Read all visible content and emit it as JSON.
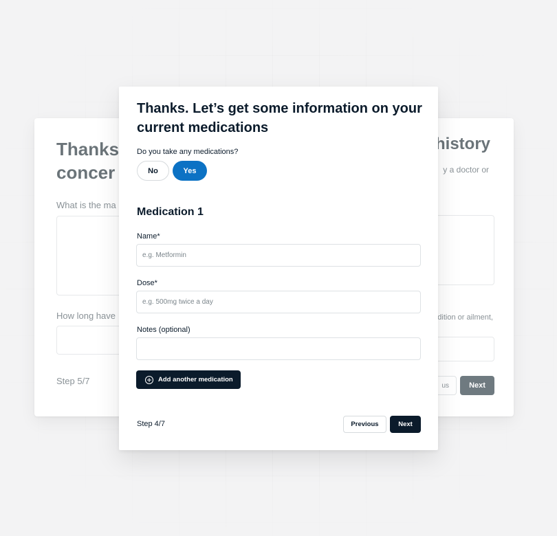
{
  "background_card": {
    "title_left": "Thanks\nconcer",
    "title_right": "history",
    "subtitle_right": "y a doctor or",
    "question_1": "What is the ma",
    "question_2": "How long have",
    "question_2_right": "dition or ailment,",
    "step": "Step 5/7",
    "previous_label": "us",
    "next_label": "Next"
  },
  "form": {
    "title": "Thanks. Let’s get some information on your current medications",
    "question": "Do you take any medications?",
    "options": [
      {
        "label": "No",
        "selected": false
      },
      {
        "label": "Yes",
        "selected": true
      }
    ],
    "section_title": "Medication 1",
    "fields": {
      "name": {
        "label": "Name*",
        "placeholder": "e.g. Metformin",
        "value": ""
      },
      "dose": {
        "label": "Dose*",
        "placeholder": "e.g. 500mg twice a day",
        "value": ""
      },
      "notes": {
        "label": "Notes (optional)",
        "placeholder": "",
        "value": ""
      }
    },
    "add_button_label": "Add another medication",
    "step": "Step 4/7",
    "previous_label": "Previous",
    "next_label": "Next"
  },
  "colors": {
    "primary": "#0b1b2b",
    "accent": "#0c72c4",
    "muted_button": "#6f7a80"
  },
  "icons": {
    "add_button_icon": "plus-circle-icon"
  }
}
